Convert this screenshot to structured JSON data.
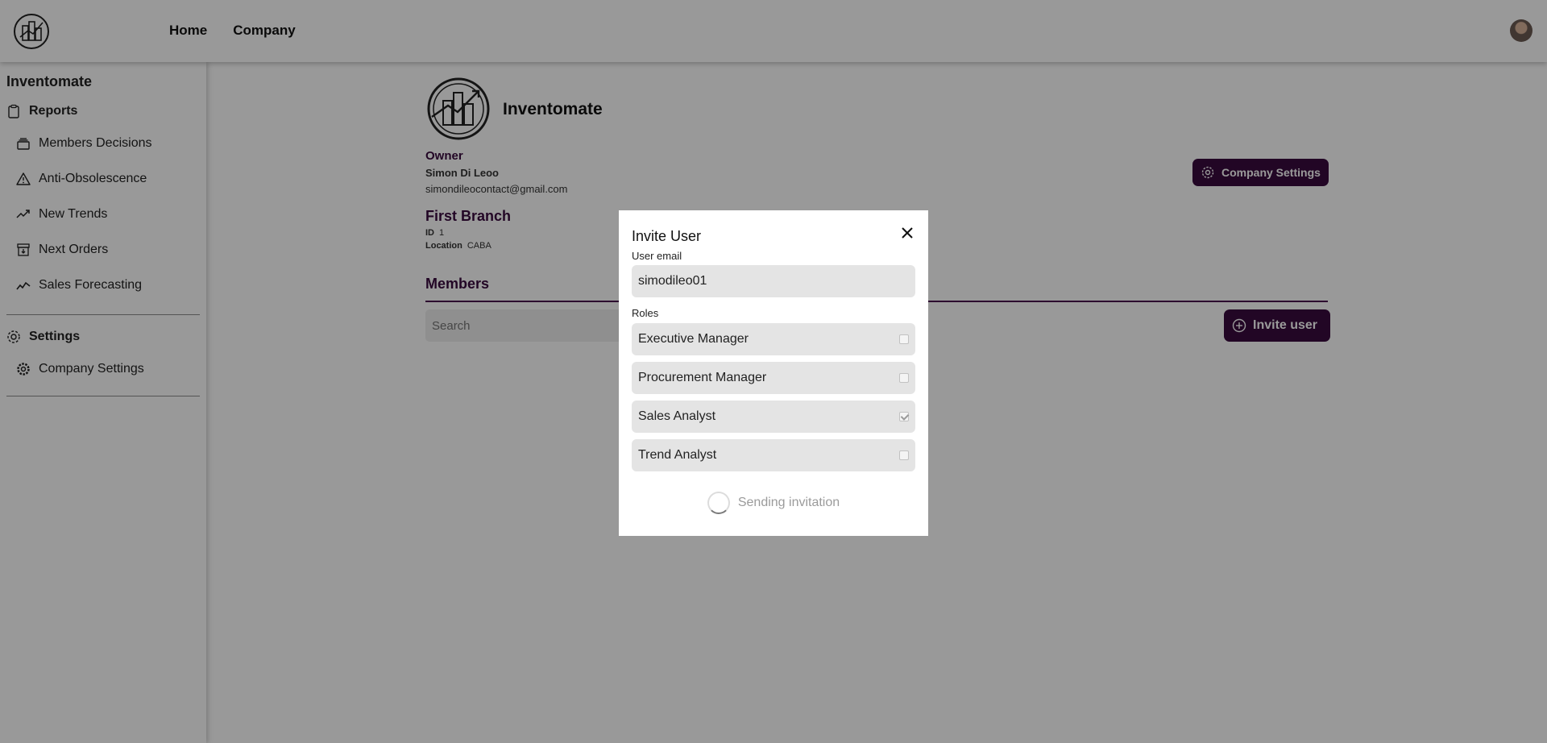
{
  "header": {
    "nav": [
      {
        "label": "Home"
      },
      {
        "label": "Company"
      }
    ]
  },
  "sidebar": {
    "app_title": "Inventomate",
    "reports_label": "Reports",
    "report_items": [
      {
        "label": "Members Decisions",
        "icon": "layers-icon"
      },
      {
        "label": "Anti-Obsolescence",
        "icon": "warning-icon"
      },
      {
        "label": "New Trends",
        "icon": "trending-up-icon"
      },
      {
        "label": "Next Orders",
        "icon": "archive-icon"
      },
      {
        "label": "Sales Forecasting",
        "icon": "line-chart-icon"
      }
    ],
    "settings_label": "Settings",
    "settings_items": [
      {
        "label": "Company Settings",
        "icon": "gear-icon"
      }
    ]
  },
  "company": {
    "name": "Inventomate",
    "owner_label": "Owner",
    "owner_name": "Simon Di Leoo",
    "owner_email": "simondileocontact@gmail.com",
    "settings_button": "Company Settings",
    "branch": {
      "title": "First Branch",
      "id_label": "ID",
      "id_value": "1",
      "location_label": "Location",
      "location_value": "CABA"
    },
    "members_title": "Members",
    "search_placeholder": "Search",
    "invite_button": "Invite user"
  },
  "modal": {
    "title": "Invite User",
    "email_label": "User email",
    "email_value": "simodileo01",
    "roles_label": "Roles",
    "roles": [
      {
        "label": "Executive Manager",
        "checked": false
      },
      {
        "label": "Procurement Manager",
        "checked": false
      },
      {
        "label": "Sales Analyst",
        "checked": true
      },
      {
        "label": "Trend Analyst",
        "checked": false
      }
    ],
    "status_text": "Sending invitation"
  },
  "colors": {
    "brand_dark": "#3a0a3f",
    "overlay": "rgba(0,0,0,0.4)"
  }
}
